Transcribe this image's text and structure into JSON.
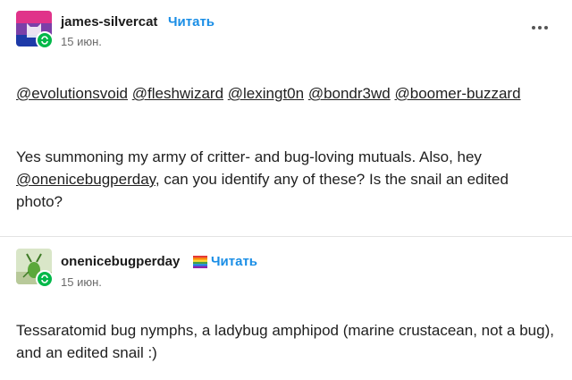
{
  "post1": {
    "username": "james-silvercat",
    "follow_label": "Читать",
    "date": "15 июн.",
    "mentions": [
      "@evolutionsvoid",
      "@fleshwizard",
      "@lexingt0n",
      "@bondr3wd",
      "@boomer-buzzard"
    ],
    "text_part1": "Yes summoning my army of critter- and bug-loving mutuals. Also, hey ",
    "text_mention": "@onenicebugperday",
    "text_part2": ", can you identify any of these? Is the snail an edited photo?"
  },
  "post2": {
    "username": "onenicebugperday",
    "follow_label": "Читать",
    "date": "15 июн.",
    "text": "Tessaratomid bug nymphs, a ladybug amphipod (marine crustacean, not a bug), and an edited snail :)"
  },
  "icons": {
    "more": "more-options-icon",
    "reblog": "reblog-icon",
    "flag": "rainbow-flag-icon"
  },
  "colors": {
    "follow": "#1a8ee6",
    "reblog_badge": "#00b849"
  }
}
